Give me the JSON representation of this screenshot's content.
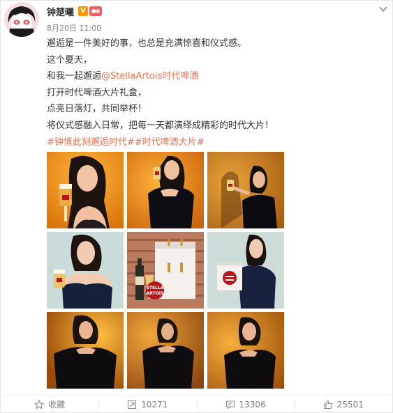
{
  "post": {
    "author": "钟楚曦",
    "badge_v": "V",
    "time": "8月20日 11:00",
    "lines": [
      "邂逅是一件美好的事，也总是充满惊喜和仪式感。",
      "这个夏天，",
      "和我一起邂逅",
      "打开时代啤酒大片礼盒，",
      "点亮日落灯，共同举杯！",
      "将仪式感融入日常，把每一天都演绎成精彩的时代大片！"
    ],
    "mention": "@StellaArtois时代啤酒",
    "hashtags": "#钟情此刻邂逅时代##时代啤酒大片#",
    "images": [
      "photo-1",
      "photo-2",
      "photo-3",
      "photo-4",
      "photo-5",
      "photo-6",
      "photo-7",
      "photo-8",
      "photo-9"
    ],
    "product_text_line1": "STELLA",
    "product_text_line2": "ARTOIS"
  },
  "actions": {
    "favorite_label": "收藏",
    "repost_count": "10271",
    "comment_count": "13306",
    "like_count": "25501"
  },
  "icons": {
    "chevron": "chevron-down-icon",
    "favorite": "star-icon",
    "repost": "repost-icon",
    "comment": "comment-icon",
    "like": "thumbs-up-icon"
  },
  "colors": {
    "link": "#eb7350",
    "muted": "#808080",
    "badge_v": "#f79a00"
  }
}
